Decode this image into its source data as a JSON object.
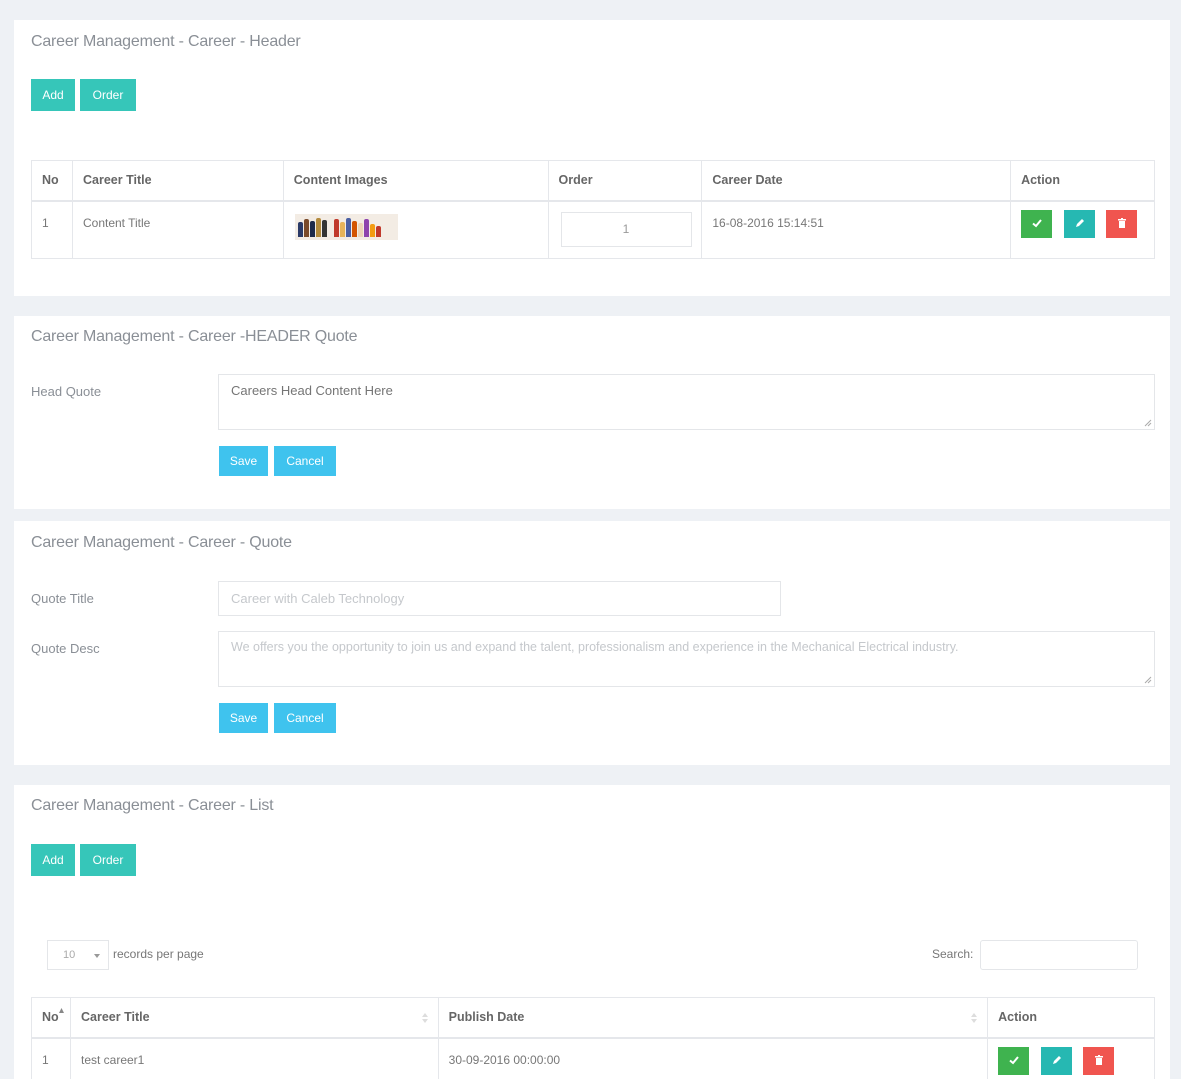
{
  "header_panel": {
    "title": "Career Management - Career - Header",
    "add_label": "Add",
    "order_label": "Order",
    "columns": [
      "No",
      "Career Title",
      "Content Images",
      "Order",
      "Career Date",
      "Action"
    ],
    "rows": [
      {
        "no": "1",
        "title": "Content Title",
        "order": "1",
        "date": "16-08-2016 15:14:51"
      }
    ]
  },
  "header_quote_panel": {
    "title": "Career Management - Career -HEADER Quote",
    "head_quote_label": "Head Quote",
    "head_quote_placeholder": "Careers Head Content Here",
    "save_label": "Save",
    "cancel_label": "Cancel"
  },
  "quote_panel": {
    "title": "Career Management - Career - Quote",
    "quote_title_label": "Quote Title",
    "quote_title_value": "Career with Caleb Technology",
    "quote_desc_label": "Quote Desc",
    "quote_desc_value": "We offers you the opportunity to join us and expand the talent, professionalism and experience in the Mechanical Electrical industry.",
    "save_label": "Save",
    "cancel_label": "Cancel"
  },
  "list_panel": {
    "title": "Career Management - Career - List",
    "add_label": "Add",
    "order_label": "Order",
    "page_size": "10",
    "records_per_page_label": "records per page",
    "search_label": "Search:",
    "search_value": "",
    "columns": [
      "No",
      "Career Title",
      "Publish Date",
      "Action"
    ],
    "rows": [
      {
        "no": "1",
        "title": "test career1",
        "date": "30-09-2016 00:00:00"
      }
    ]
  },
  "colors": {
    "teal": "#36c6b9",
    "blue": "#3fc3ee",
    "green": "#3fb34f",
    "red": "#f0554f",
    "background": "#eef1f5"
  },
  "icons": [
    "check-icon",
    "pencil-icon",
    "trash-icon",
    "resize-grip-icon",
    "sort-icon",
    "caret-down-icon"
  ]
}
